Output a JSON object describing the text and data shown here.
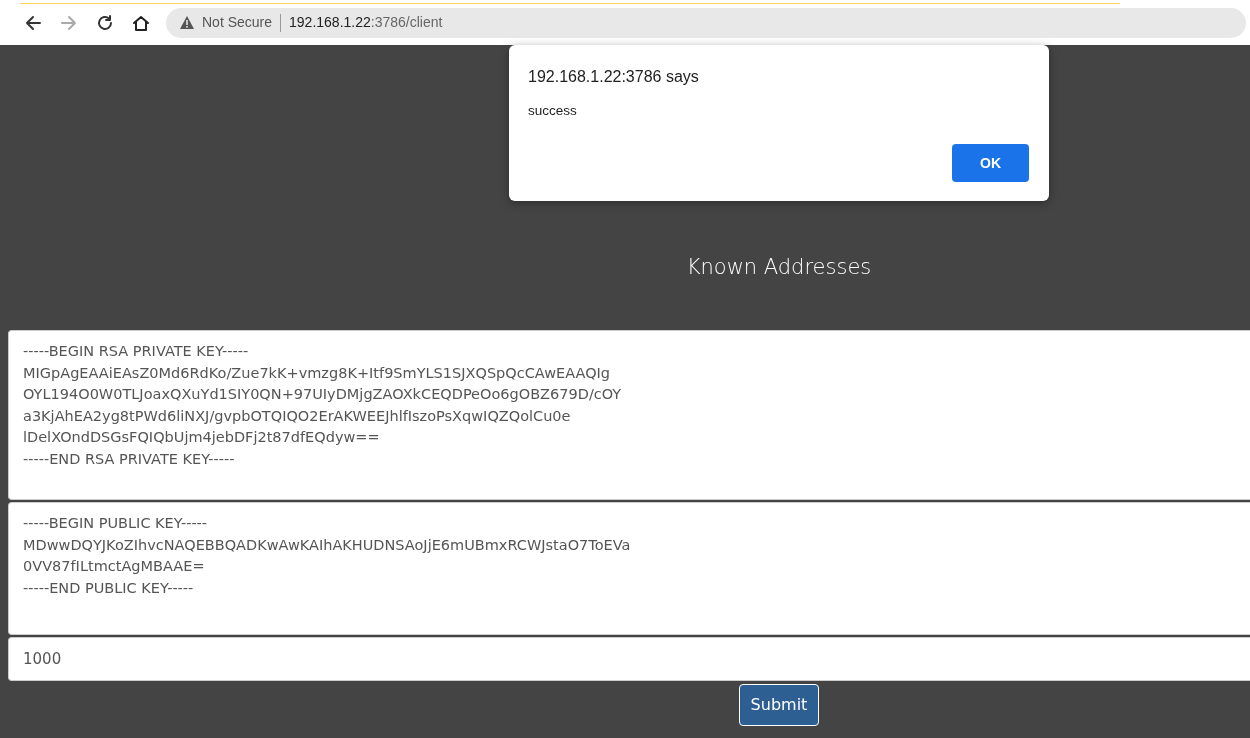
{
  "browser": {
    "security_label": "Not Secure",
    "url_host": "192.168.1.22",
    "url_path": ":3786/client",
    "forward_disabled": true
  },
  "page": {
    "heading": "Known Addresses",
    "private_key": [
      "-----BEGIN RSA PRIVATE KEY-----",
      "MIGpAgEAAiEAsZ0Md6RdKo/Zue7kK+vmzg8K+Itf9SmYLS1SJXQSpQcCAwEAAQIg",
      "OYL194O0W0TLJoaxQXuYd1SIY0QN+97UIyDMjgZAOXkCEQDPeOo6gOBZ679D/cOY",
      "a3KjAhEA2yg8tPWd6liNXJ/gvpbOTQIQO2ErAKWEEJhlfIszoPsXqwIQZQolCu0e",
      "lDelXOndDSGsFQIQbUjm4jebDFj2t87dfEQdyw==",
      "-----END RSA PRIVATE KEY-----"
    ],
    "public_key": [
      "-----BEGIN PUBLIC KEY-----",
      "MDwwDQYJKoZIhvcNAQEBBQADKwAwKAIhAKHUDNSAoJjE6mUBmxRCWJstaO7ToEVa",
      "0VV87fILtmctAgMBAAE=",
      "-----END PUBLIC KEY-----"
    ],
    "amount": "1000",
    "submit": "Submit"
  },
  "dialog": {
    "title": "192.168.1.22:3786 says",
    "message": "success",
    "ok": "OK"
  }
}
